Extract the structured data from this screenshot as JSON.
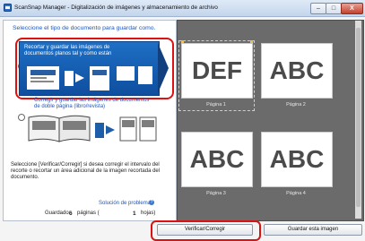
{
  "window": {
    "title": "ScanSnap Manager - Digitalización de imágenes y almacenamiento de archivo",
    "close_glyph": "X"
  },
  "left_panel": {
    "instruction": "Seleccione el tipo de documento para guardar como.",
    "option_flat": "Recortar y guardar las imágenes de documentos planos tal y como están",
    "option_book": "Corregir y guardar las imágenes de documentos de doble página (libro/revista)",
    "description": "Seleccione [Verificar/Corregir] si desea corregir el intervalo del recorte o recortar un área adicional de la imagen recortada del documento.",
    "trouble_link": "Solución de problemas",
    "saved_label": "Guardado:",
    "saved_pages": "6",
    "pages_word": "páginas (",
    "saved_sheets": "1",
    "sheets_word": "hojas)"
  },
  "thumbnails": [
    {
      "text": "DEF",
      "caption": "Página 1"
    },
    {
      "text": "ABC",
      "caption": "Página 2"
    },
    {
      "text": "ABC",
      "caption": "Página 3"
    },
    {
      "text": "ABC",
      "caption": "Página 4"
    }
  ],
  "buttons": {
    "verify": "Verificar/Corregir",
    "save": "Guardar esta imagen"
  },
  "colors": {
    "accent": "#1f56b8",
    "highlight": "#d11111",
    "selected_option": "#1d6fc5"
  }
}
